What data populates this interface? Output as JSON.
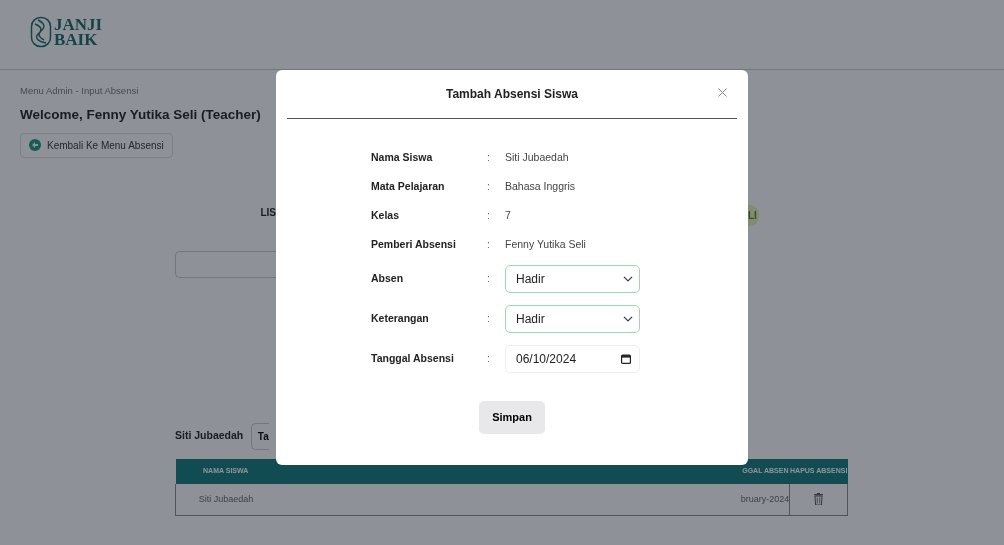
{
  "header": {
    "logo_lines": [
      "JANJI",
      "BAIK"
    ]
  },
  "breadcrumb": "Menu Admin - Input Absensi",
  "welcome": "Welcome, Fenny Yutika Seli (Teacher)",
  "back_button": {
    "label": "Kembali Ke Menu Absensi"
  },
  "list_title_fragment": "LIS",
  "badge_fragment": "LI",
  "filter": {
    "label": "Siti Jubaedah",
    "button_fragment": "Ta"
  },
  "table": {
    "columns": [
      "NAMA SISWA",
      "GGAL ABSEN",
      "HAPUS ABSENSI"
    ],
    "rows": [
      {
        "nama_siswa": "Siti Jubaedah",
        "tanggal_absen": "bruary-2024"
      }
    ]
  },
  "modal": {
    "title": "Tambah Absensi Siswa",
    "fields": [
      {
        "kind": "text",
        "label": "Nama Siswa",
        "value": "Siti Jubaedah"
      },
      {
        "kind": "text",
        "label": "Mata Pelajaran",
        "value": "Bahasa Inggris"
      },
      {
        "kind": "text",
        "label": "Kelas",
        "value": "7"
      },
      {
        "kind": "text",
        "label": "Pemberi Absensi",
        "value": "Fenny Yutika Seli"
      },
      {
        "kind": "select",
        "label": "Absen",
        "value": "Hadir"
      },
      {
        "kind": "select",
        "label": "Keterangan",
        "value": "Hadir"
      },
      {
        "kind": "date",
        "label": "Tanggal Absensi",
        "value": "06/10/2024"
      }
    ],
    "separator": ":",
    "submit": "Simpan"
  }
}
